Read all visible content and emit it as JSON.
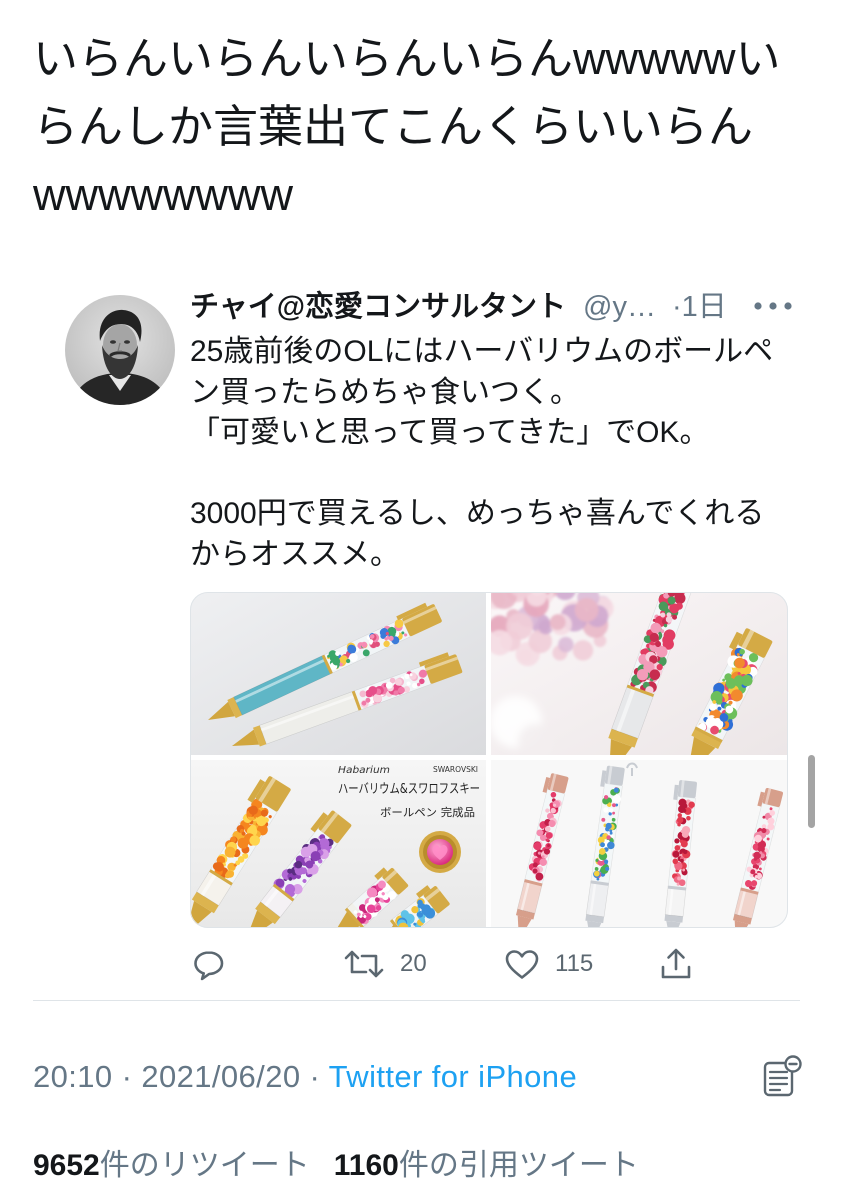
{
  "tweet": {
    "text_lines": [
      "いらんいらんいらんいらんwwwwwい",
      "らんしか言葉出てこんくらいいらん",
      "wwwwwwww"
    ],
    "meta": {
      "time_date": "20:10 · 2021/06/20 · ",
      "source": "Twitter for iPhone"
    },
    "stats": {
      "retweet_count": "9652",
      "retweet_label": "件のリツイート",
      "quote_count": "1160",
      "quote_label": "件の引用ツイート"
    }
  },
  "quoted_tweet": {
    "author": {
      "display_name": "チャイ@恋愛コンサルタント",
      "handle": "@y…",
      "age": "·1日"
    },
    "paragraphs": [
      [
        "25歳前後のOLにはハーバリウムのボールペ",
        "ン買ったらめちゃ食いつく。",
        "「可愛いと思って買ってきた」でOK。"
      ],
      [
        "3000円で買えるし、めっちゃ喜んでくれる",
        "からオススメ。"
      ]
    ],
    "media_text": {
      "brand_en": "Habarium",
      "crystal_brand": "SWAROVSKI",
      "product_title": "ハーバリウム&スワロフスキー",
      "product_subtitle": "ボールペン 完成品"
    },
    "actions": {
      "retweet_count": "20",
      "like_count": "115"
    }
  },
  "icons": {
    "avatar": "portrait-avatar",
    "more": "more-icon",
    "reply": "reply-icon",
    "retweet": "retweet-icon",
    "like": "heart-icon",
    "share": "share-icon",
    "quote_list": "quote-list-icon"
  },
  "colors": {
    "primary_text": "#14171a",
    "secondary_text": "#657786",
    "link": "#1da1f2",
    "divider": "#dfe4e8",
    "background": "#ffffff"
  }
}
